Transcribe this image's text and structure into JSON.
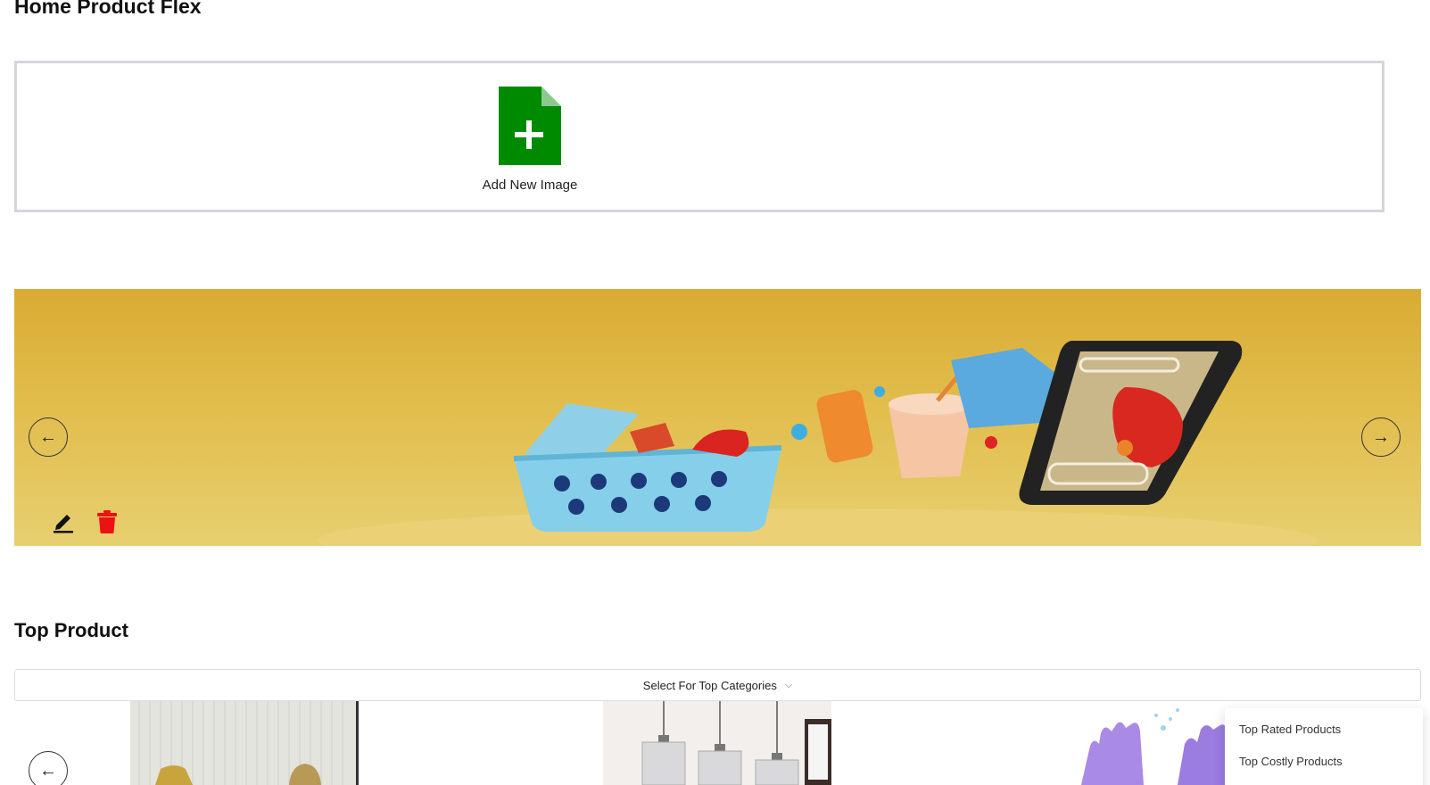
{
  "page": {
    "title": "Home Product Flex"
  },
  "upload": {
    "add_label": "Add New Image",
    "icon": "file-plus-icon",
    "icon_color": "#008a00"
  },
  "banner": {
    "prev_icon": "←",
    "next_icon": "→",
    "edit_icon": "pencil-icon",
    "delete_icon": "trash-icon",
    "delete_color": "#ee1111"
  },
  "top_product": {
    "title": "Top Product",
    "select_label": "Select For Top Categories",
    "select_chevron": "⌵",
    "prev_icon": "←",
    "options": [
      {
        "label": "Top Rated Products"
      },
      {
        "label": "Top Costly Products"
      }
    ]
  }
}
